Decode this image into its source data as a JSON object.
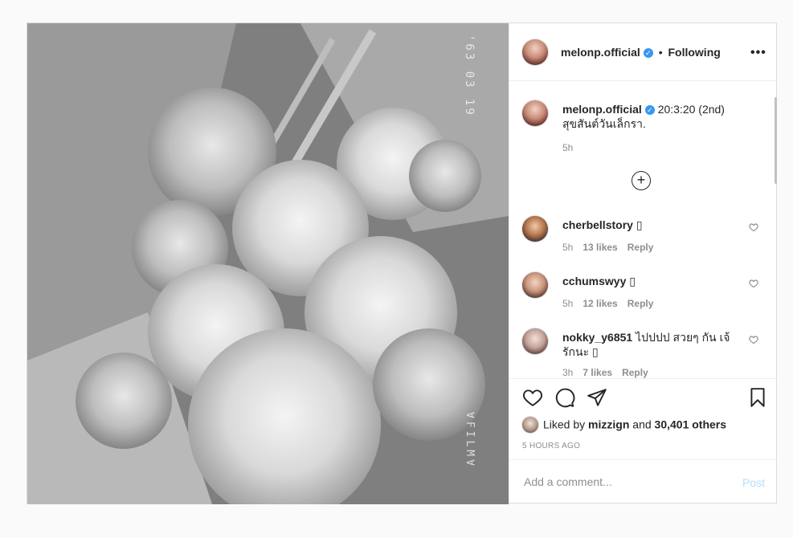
{
  "photo": {
    "stamp_top": "'63 03 19",
    "stamp_bottom": "∀FILM∀"
  },
  "header": {
    "username": "melonp.official",
    "separator": "•",
    "follow_status": "Following",
    "more_label": "•••"
  },
  "caption": {
    "username": "melonp.official",
    "text": "20:3:20 (2nd)",
    "text_line2": "สุขสันต์วันเล็กรา.",
    "time": "5h"
  },
  "load_more_label": "+",
  "comments": [
    {
      "username": "cherbellstory",
      "text": "▯",
      "time": "5h",
      "likes": "13 likes",
      "reply": "Reply"
    },
    {
      "username": "cchumswyy",
      "text": "▯",
      "time": "5h",
      "likes": "12 likes",
      "reply": "Reply"
    },
    {
      "username": "nokky_y6851",
      "text": "ไปปปป สวยๆ กัน เจ้รักนะ ▯",
      "time": "3h",
      "likes": "7 likes",
      "reply": "Reply"
    }
  ],
  "likes": {
    "prefix": "Liked by",
    "user": "mizzign",
    "middle": "and",
    "others": "30,401 others"
  },
  "time_ago": "5 HOURS AGO",
  "add_comment": {
    "placeholder": "Add a comment...",
    "post_label": "Post"
  },
  "colors": {
    "verified": "#3897f0",
    "post_button_disabled": "#b2dffc",
    "muted": "#8e8e8e"
  }
}
